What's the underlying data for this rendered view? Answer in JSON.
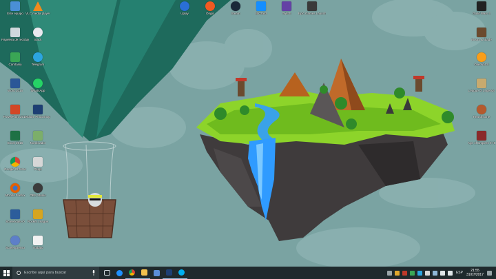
{
  "desktop_icons": [
    {
      "label": "Este equipo",
      "icon": "computer-icon",
      "color": "#4a8fd6"
    },
    {
      "label": "VLC media player",
      "icon": "vlc-icon",
      "color": "#f08a1c"
    },
    {
      "label": "Papelera de reciclaje",
      "icon": "recycle-bin-icon",
      "color": "#cfd8dc"
    },
    {
      "label": "Slack",
      "icon": "slack-icon",
      "color": "#e9e9ef"
    },
    {
      "label": "Camtasia",
      "icon": "camtasia-icon",
      "color": "#3aa655"
    },
    {
      "label": "Telegram",
      "icon": "telegram-icon",
      "color": "#2ca5e0"
    },
    {
      "label": "Word 2016",
      "icon": "word-icon",
      "color": "#2b5797"
    },
    {
      "label": "WhatsApp",
      "icon": "whatsapp-icon",
      "color": "#25d366"
    },
    {
      "label": "PowerPoint 2016",
      "icon": "powerpoint-icon",
      "color": "#d24726"
    },
    {
      "label": "Adobe Photoshop",
      "icon": "photoshop-icon",
      "color": "#1d3f73"
    },
    {
      "label": "Excel 2016",
      "icon": "excel-icon",
      "color": "#1e7145"
    },
    {
      "label": "Nombrador",
      "icon": "app-icon",
      "color": "#7cae6a"
    },
    {
      "label": "Google Chrome",
      "icon": "chrome-icon",
      "color": "#e0a82e"
    },
    {
      "label": "Plugs",
      "icon": "plug-icon",
      "color": "#d7d7d7"
    },
    {
      "label": "Mozilla Firefox",
      "icon": "firefox-icon",
      "color": "#e66000"
    },
    {
      "label": "OBS Studio",
      "icon": "obs-icon",
      "color": "#3b3b3b"
    },
    {
      "label": "Screencast-O",
      "icon": "screencast-icon",
      "color": "#2c5d9b"
    },
    {
      "label": "Rocket League",
      "icon": "rocket-league-icon",
      "color": "#d6a520"
    },
    {
      "label": "Screenpresso",
      "icon": "screenpresso-icon",
      "color": "#5d7fc8"
    },
    {
      "label": "Trabajo",
      "icon": "document-icon",
      "color": "#f2f2f2"
    }
  ],
  "top_icons": [
    {
      "label": "Uplay",
      "icon": "uplay-icon",
      "color": "#2a6fd6"
    },
    {
      "label": "Origin",
      "icon": "origin-icon",
      "color": "#f05a22"
    },
    {
      "label": "Steam",
      "icon": "steam-icon",
      "color": "#1b2838"
    },
    {
      "label": "Blizzard",
      "icon": "battlenet-icon",
      "color": "#148eff"
    },
    {
      "label": "Twitch",
      "icon": "twitch-icon",
      "color": "#6441a5"
    },
    {
      "label": "Epic Games Launcher",
      "icon": "epic-icon",
      "color": "#3a3a3a"
    }
  ],
  "right_icons": [
    {
      "label": "Guild Wars 2",
      "icon": "gw2-icon",
      "color": "#222222"
    },
    {
      "label": "Mount & Blade",
      "icon": "game-icon",
      "color": "#6b4a2e"
    },
    {
      "label": "Overwatch",
      "icon": "overwatch-icon",
      "color": "#f99e1a"
    },
    {
      "label": "League of Legends",
      "icon": "lol-icon",
      "color": "#c8aa6e"
    },
    {
      "label": "Hearthstone",
      "icon": "hearthstone-icon",
      "color": "#b45a2e"
    },
    {
      "label": "Age of Empires II HD",
      "icon": "aoe-icon",
      "color": "#8a2a2a"
    }
  ],
  "taskbar": {
    "search_placeholder": "Escribe aquí para buscar",
    "pinned": [
      {
        "name": "task-view-icon",
        "color": "#cfd8dc"
      },
      {
        "name": "edge-icon",
        "color": "#1e90ff"
      },
      {
        "name": "chrome-icon",
        "color": "#e0a82e"
      },
      {
        "name": "file-explorer-icon",
        "color": "#f2c14e"
      },
      {
        "name": "store-icon",
        "color": "#5a8ed8"
      },
      {
        "name": "photoshop-icon",
        "color": "#1d3f73"
      },
      {
        "name": "skype-icon",
        "color": "#00aff0"
      }
    ],
    "language": "ESP",
    "time": "21:55",
    "date": "31/07/2017"
  }
}
